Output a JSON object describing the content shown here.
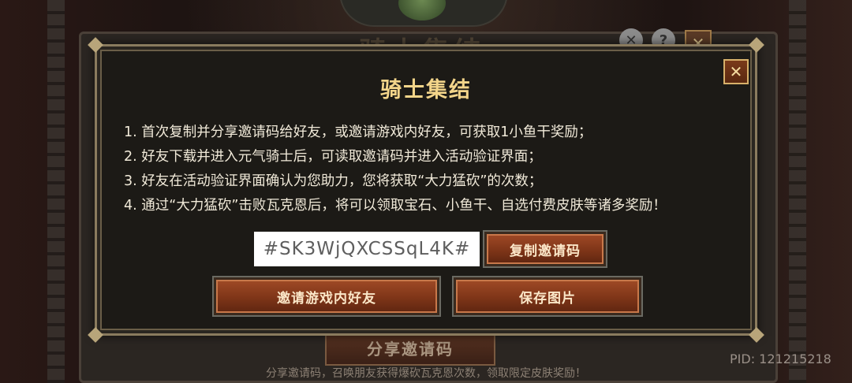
{
  "background": {
    "title": "骑士集结",
    "share_button": "分享邀请码",
    "footer": "分享邀请码，召唤朋友获得爆砍瓦克恩次数，领取限定皮肤奖励！",
    "pid": "PID: 121215218",
    "icons": [
      "mute-icon",
      "help-icon",
      "close-icon"
    ]
  },
  "modal": {
    "title": "骑士集结",
    "close_label": "✕",
    "rules": [
      "1. 首次复制并分享邀请码给好友，或邀请游戏内好友，可获取1小鱼干奖励；",
      "2. 好友下载并进入元气骑士后，可读取邀请码并进入活动验证界面；",
      "3. 好友在活动验证界面确认为您助力，您将获取“大力猛砍”的次数；",
      "4. 通过“大力猛砍”击败瓦克恩后，将可以领取宝石、小鱼干、自选付费皮肤等诸多奖励！"
    ],
    "invite_code": "#SK3WjQXCSSqL4K#",
    "copy_button": "复制邀请码",
    "invite_friends_button": "邀请游戏内好友",
    "save_image_button": "保存图片"
  },
  "colors": {
    "title": "#f3d58a",
    "button": "#8e3c1c",
    "modal_bg": "#1c1a16",
    "border": "#8a7b5e"
  }
}
